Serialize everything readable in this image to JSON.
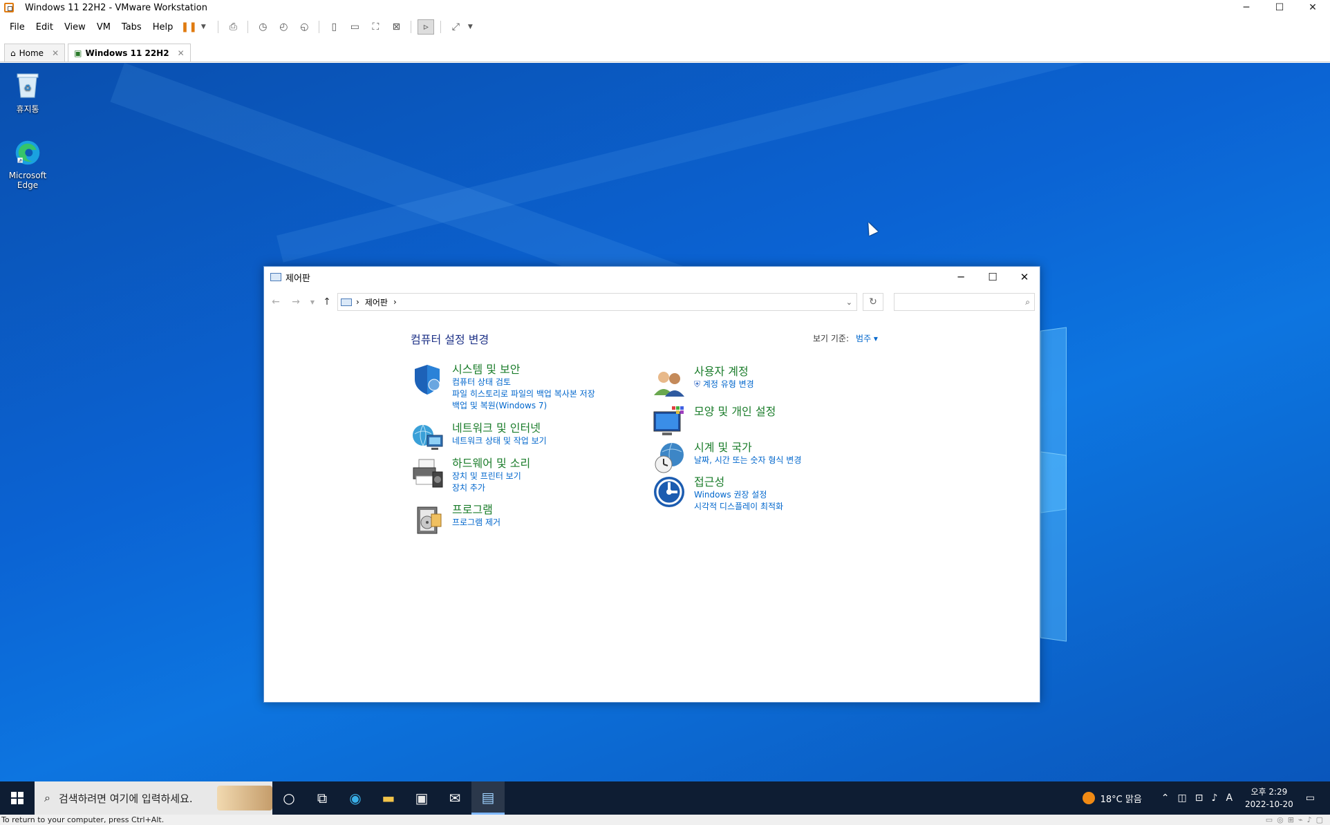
{
  "vm_window": {
    "title": "Windows 11 22H2 - VMware Workstation",
    "controls": {
      "minimize": "─",
      "maximize": "☐",
      "close": "✕"
    }
  },
  "menu": [
    "File",
    "Edit",
    "View",
    "VM",
    "Tabs",
    "Help"
  ],
  "tabs": [
    {
      "label": "Home",
      "close": "✕"
    },
    {
      "label": "Windows 11 22H2",
      "close": "✕"
    }
  ],
  "desktop_icons": [
    {
      "label": "휴지통",
      "icon": "recycle-bin-icon"
    },
    {
      "label": "Microsoft Edge",
      "icon": "edge-icon"
    }
  ],
  "control_panel": {
    "title": "제어판",
    "breadcrumb": "제어판",
    "heading": "컴퓨터 설정 변경",
    "view_by_label": "보기 기준:",
    "view_by_value": "범주 ▾",
    "categories": [
      {
        "title": "시스템 및 보안",
        "icon": "shield-icon",
        "links": [
          "컴퓨터 상태 검토",
          "파일 히스토리로 파일의 백업 복사본 저장",
          "백업 및 복원(Windows 7)"
        ]
      },
      {
        "title": "네트워크 및 인터넷",
        "icon": "network-globe-icon",
        "links": [
          "네트워크 상태 및 작업 보기"
        ]
      },
      {
        "title": "하드웨어 및 소리",
        "icon": "printer-icon",
        "links": [
          "장치 및 프린터 보기",
          "장치 추가"
        ]
      },
      {
        "title": "프로그램",
        "icon": "programs-icon",
        "links": [
          "프로그램 제거"
        ]
      },
      {
        "title": "사용자 계정",
        "icon": "users-icon",
        "links": [
          "계정 유형 변경"
        ]
      },
      {
        "title": "모양 및 개인 설정",
        "icon": "appearance-icon",
        "links": []
      },
      {
        "title": "시계 및 국가",
        "icon": "clock-globe-icon",
        "links": [
          "날짜, 시간 또는 숫자 형식 변경"
        ]
      },
      {
        "title": "접근성",
        "icon": "accessibility-icon",
        "links": [
          "Windows 권장 설정",
          "시각적 디스플레이 최적화"
        ]
      }
    ]
  },
  "taskbar": {
    "search_placeholder": "검색하려면 여기에 입력하세요.",
    "weather": "18°C  맑음",
    "time": "오후 2:29",
    "date": "2022-10-20",
    "ime": "A"
  },
  "status_bar": "To return to your computer, press Ctrl+Alt.",
  "colors": {
    "desktop": "#0b63d3",
    "taskbar": "#0e1d33",
    "category_title": "#1a7c2a",
    "link": "#0066cc",
    "heading": "#1e3287"
  }
}
